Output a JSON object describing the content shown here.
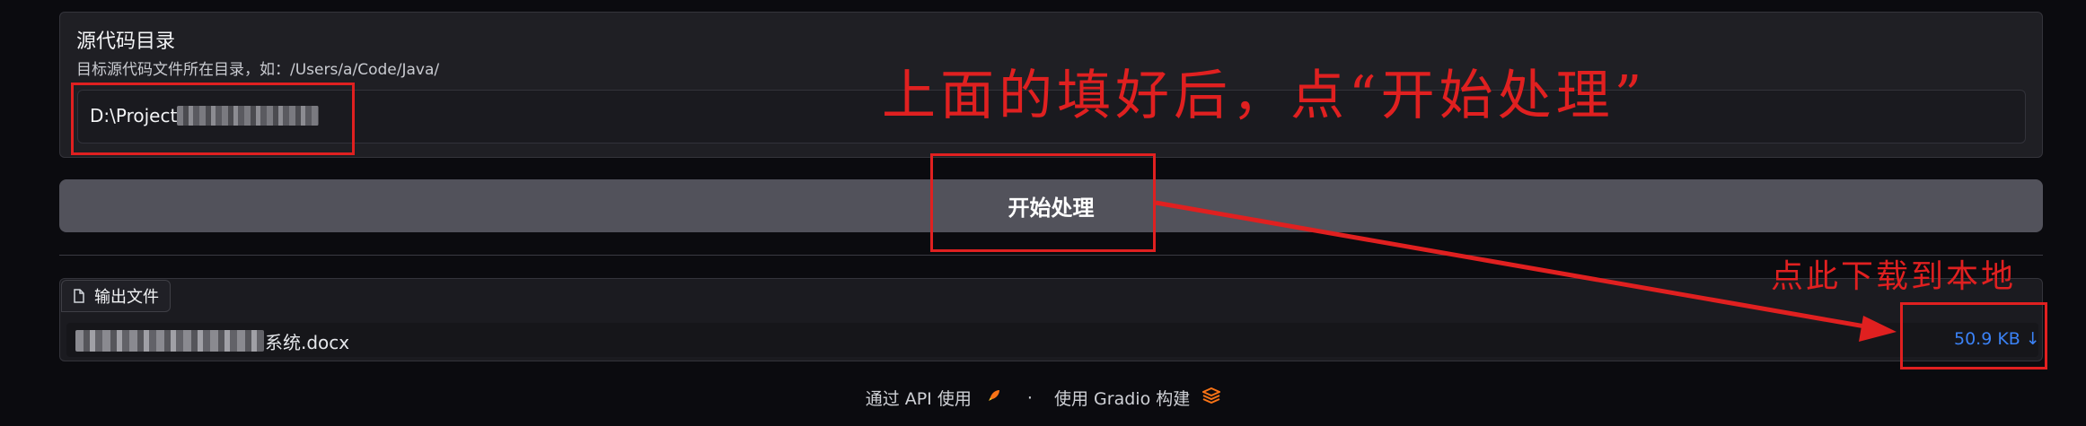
{
  "source": {
    "title": "源代码目录",
    "info": "目标源代码文件所在目录，如：/Users/a/Code/Java/",
    "value_prefix": "D:\\Project\\"
  },
  "submit": {
    "label": "开始处理"
  },
  "output": {
    "tab_label": "输出文件",
    "file_name_suffix": "系统.docx",
    "file_size": "50.9 KB ↓"
  },
  "footer": {
    "api_label": "通过 API 使用",
    "separator": "·",
    "built_with": "使用 Gradio 构建"
  },
  "annotations": {
    "top_note": "上面的填好后，点“开始处理”",
    "download_note": "点此下载到本地"
  },
  "colors": {
    "annotation_red": "#e02020",
    "link_blue": "#3b82f6",
    "button_gray": "#52525b",
    "background": "#0b0b0f"
  },
  "icons": {
    "tab_icon": "file-icon",
    "api_icon": "rocket-icon",
    "gradio_icon": "gradio-logo-icon"
  }
}
